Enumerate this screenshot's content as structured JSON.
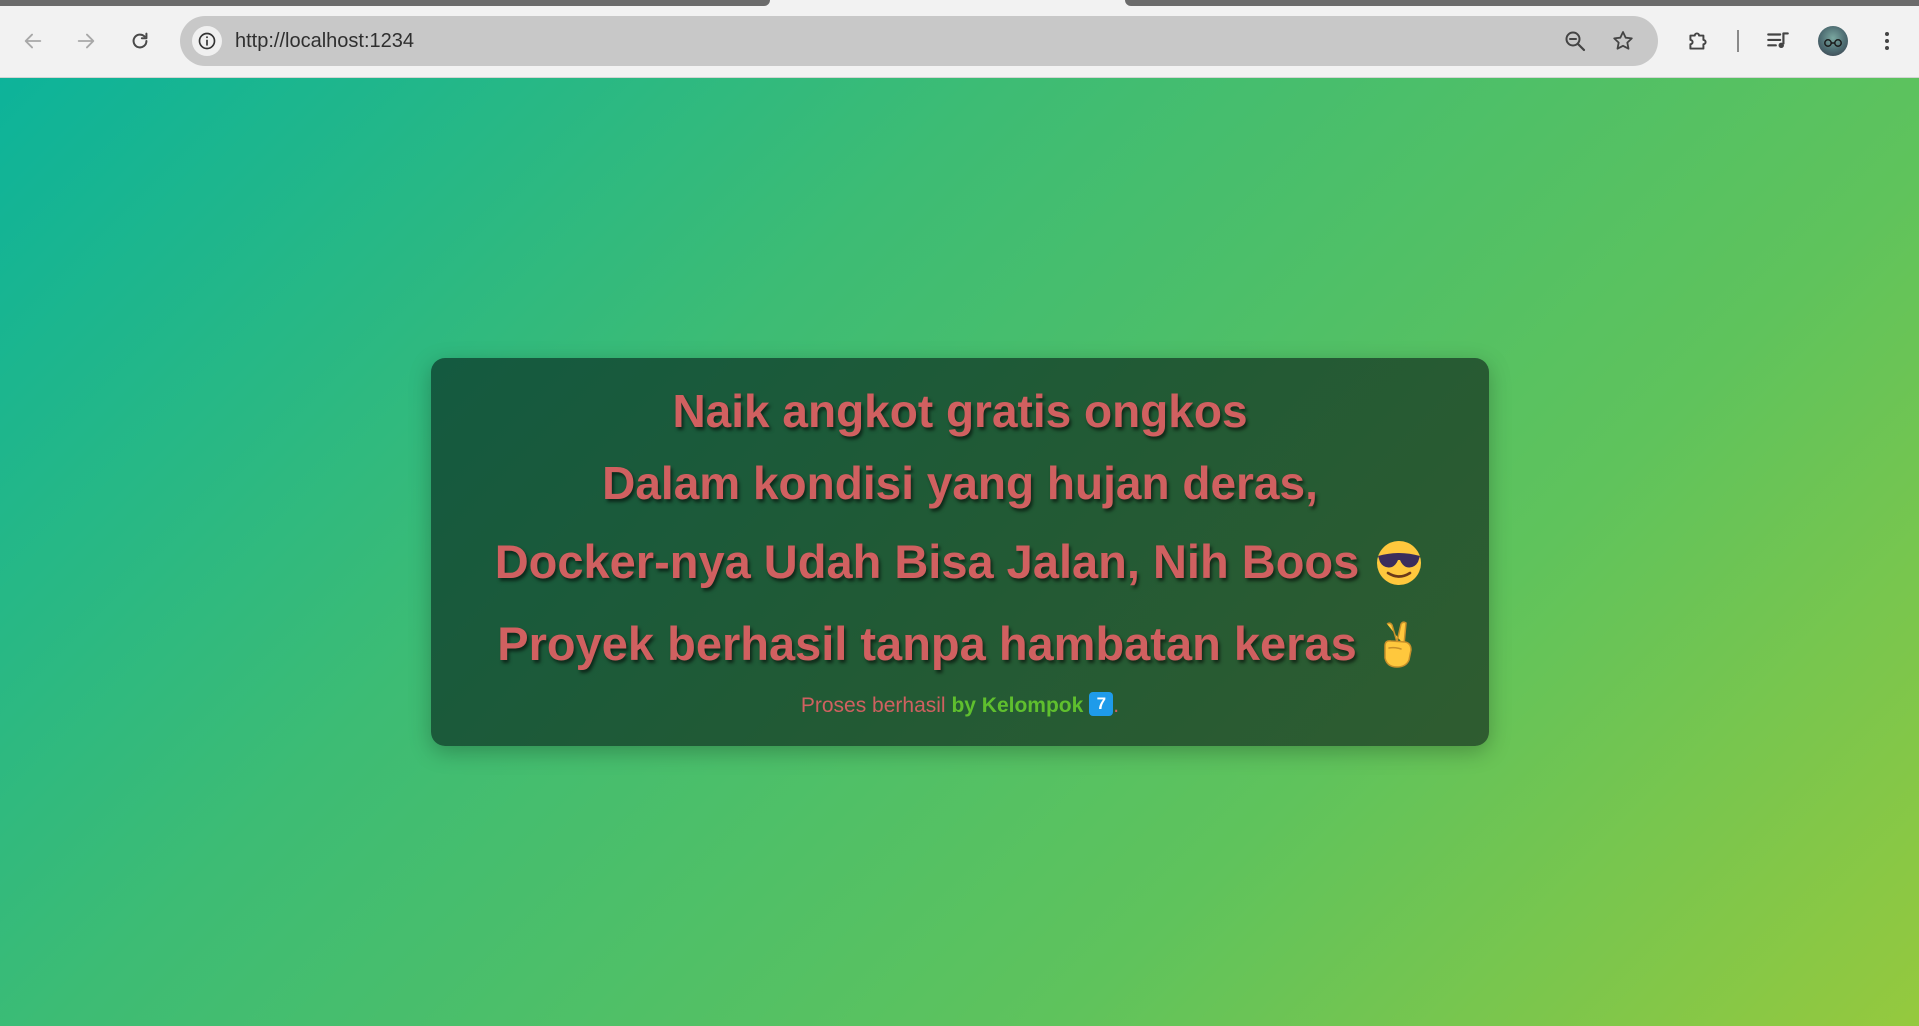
{
  "browser": {
    "url": "http://localhost:1234",
    "icons": {
      "back": "arrow-left-icon",
      "forward": "arrow-right-icon",
      "reload": "reload-icon",
      "site_info": "info-icon",
      "zoom": "zoom-out-icon",
      "bookmark": "star-icon",
      "extensions": "puzzle-icon",
      "media": "media-queue-icon",
      "menu": "kebab-menu-icon"
    }
  },
  "page": {
    "background_colors": [
      "#0db39a",
      "#3dbc74",
      "#95c93e"
    ],
    "card_color": "#1f5a3a",
    "text_color": "#d06060",
    "accent_color": "#5fbf2e",
    "lines": [
      "Naik angkot gratis ongkos",
      "Dalam kondisi yang hujan deras,",
      "Docker-nya Udah Bisa Jalan, Nih Boos",
      "Proyek berhasil tanpa hambatan keras"
    ],
    "line3_emoji": "sunglasses-face-icon",
    "line4_emoji": "victory-hand-icon",
    "footer": {
      "prefix": "Proses berhasil ",
      "by": "by Kelompok",
      "badge": "7",
      "suffix": "."
    }
  }
}
